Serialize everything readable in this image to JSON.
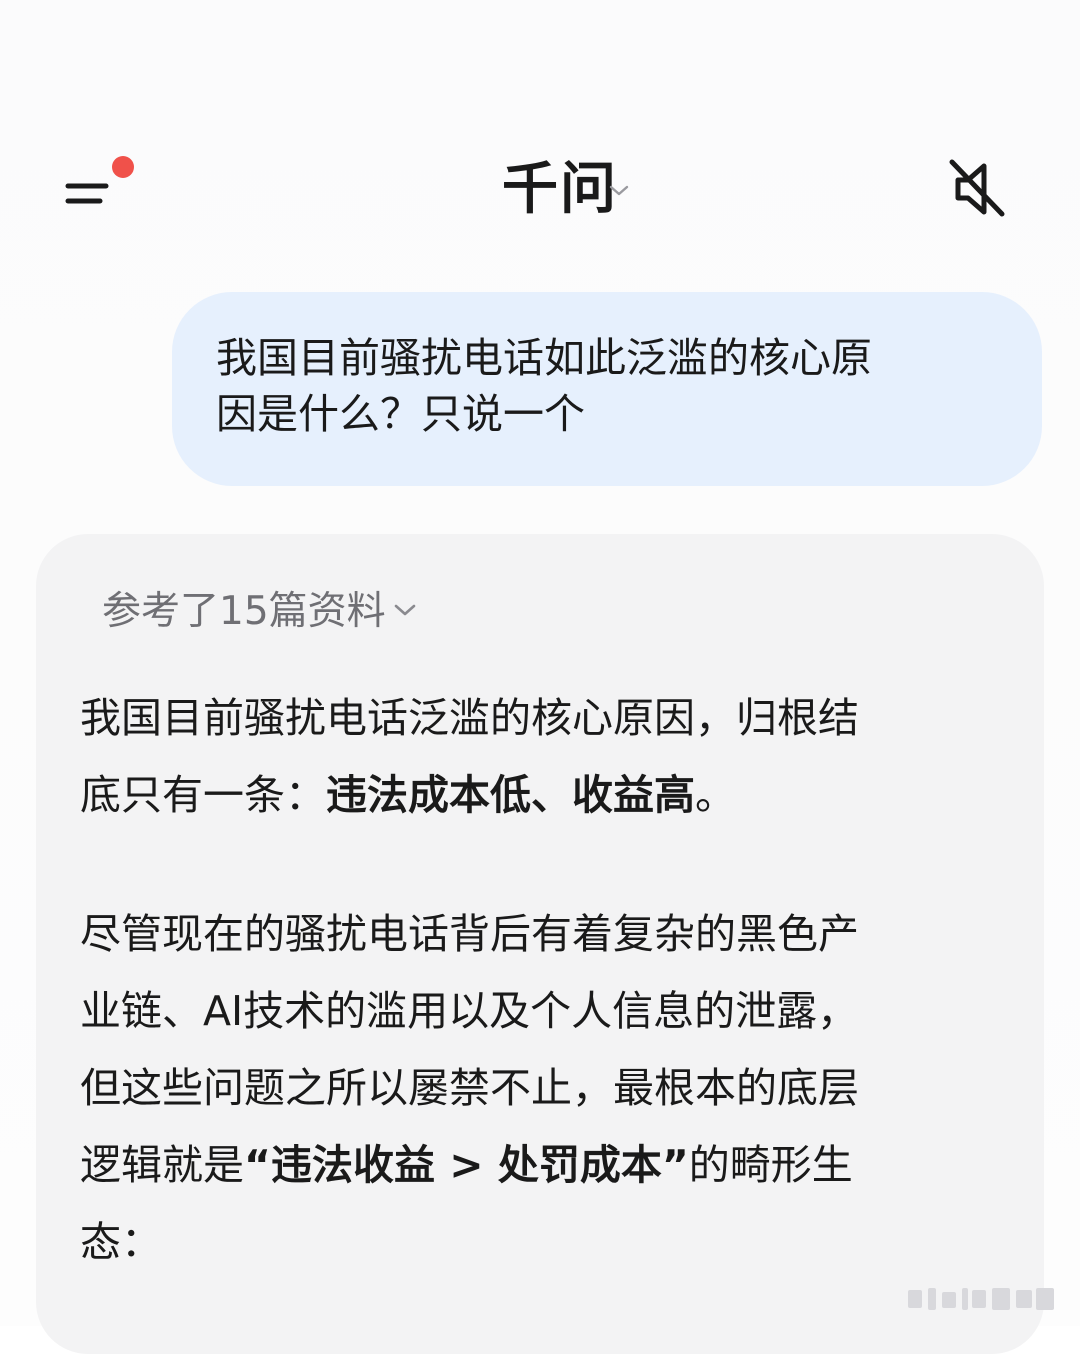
{
  "header": {
    "title": "千问",
    "menu_icon": "menu-icon",
    "notification_color": "#f0514a",
    "mute_icon": "speaker-mute-icon"
  },
  "conversation": {
    "user_message": {
      "line1": "我国目前骚扰电话如此泛滥的核心原",
      "line2": "因是什么？只说一个"
    },
    "answer": {
      "references_label": "参考了15篇资料",
      "para1": {
        "text1": "我国目前骚扰电话泛滥的核心原因，归根结",
        "text2": "底只有一条：",
        "bold": "违法成本低、收益高",
        "text3": "。"
      },
      "para2": {
        "line1": "尽管现在的骚扰电话背后有着复杂的黑色产",
        "line2": "业链、AI技术的滥用以及个人信息的泄露，",
        "line3": "但这些问题之所以屡禁不止，最根本的底层",
        "prefix": "逻辑就是",
        "bold": "“违法收益 > 处罚成本”",
        "suffix": "的畸形生",
        "line5": "态："
      }
    }
  },
  "colors": {
    "user_bubble": "#e6f0fd",
    "answer_card": "#f3f3f4",
    "muted_text": "#6f6f74"
  }
}
